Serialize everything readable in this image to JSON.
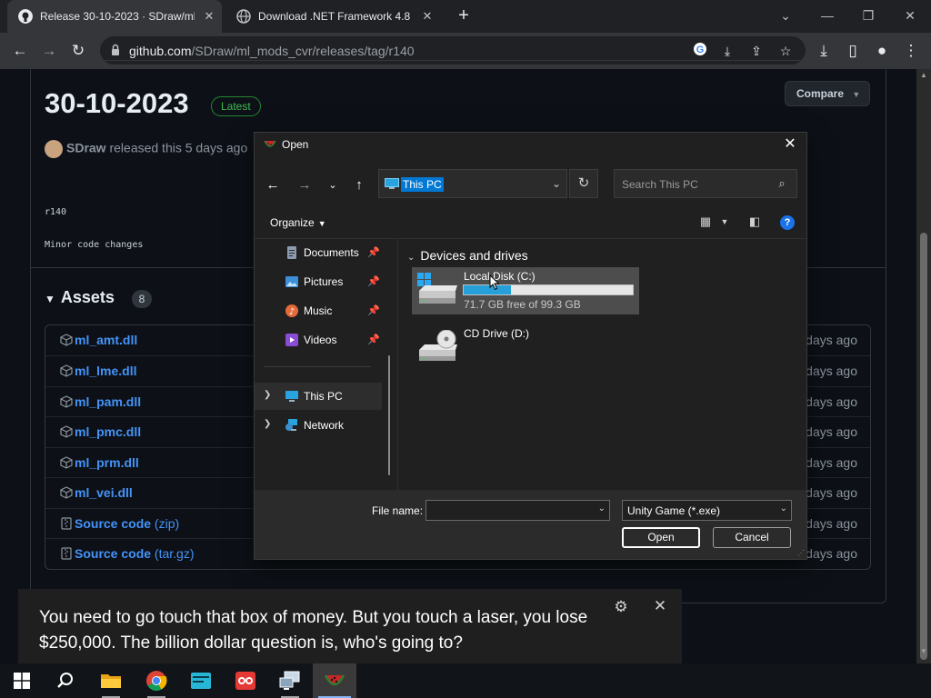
{
  "browser": {
    "tabs": [
      {
        "title": "Release 30-10-2023 · SDraw/ml_",
        "icon": "github-icon",
        "active": true
      },
      {
        "title": "Download .NET Framework 4.8 \\",
        "icon": "globe-icon",
        "active": false
      }
    ],
    "new_tab": "+",
    "window_controls": [
      "chevron-down-icon",
      "minimize-icon",
      "restore-icon",
      "close-icon"
    ],
    "url_host": "github.com",
    "url_path": "/SDraw/ml_mods_cvr/releases/tag/r140"
  },
  "release": {
    "title": "30-10-2023",
    "badge": "Latest",
    "compare_label": "Compare",
    "author": "SDraw",
    "released_text": "released this 5 days ago",
    "tag": "r140",
    "notes": "Minor code changes",
    "assets_title": "Assets",
    "assets_count": "8",
    "assets": [
      {
        "name": "ml_amt.dll",
        "ext": "",
        "date": "days ago",
        "icon": "package-icon"
      },
      {
        "name": "ml_lme.dll",
        "ext": "",
        "date": "days ago",
        "icon": "package-icon"
      },
      {
        "name": "ml_pam.dll",
        "ext": "",
        "date": "days ago",
        "icon": "package-icon"
      },
      {
        "name": "ml_pmc.dll",
        "ext": "",
        "date": "days ago",
        "icon": "package-icon"
      },
      {
        "name": "ml_prm.dll",
        "ext": "",
        "date": "days ago",
        "icon": "package-icon"
      },
      {
        "name": "ml_vei.dll",
        "ext": "",
        "date": "days ago",
        "icon": "package-icon"
      },
      {
        "name": "Source code",
        "ext": "(zip)",
        "date": "days ago",
        "icon": "zip-icon"
      },
      {
        "name": "Source code",
        "ext": "(tar.gz)",
        "date": "days ago",
        "icon": "zip-icon"
      }
    ]
  },
  "dialog": {
    "title": "Open",
    "address": "This PC",
    "search_placeholder": "Search This PC",
    "organize_label": "Organize",
    "nav_quick": [
      {
        "label": "Documents",
        "icon": "documents-icon",
        "color": "#8e9ab0"
      },
      {
        "label": "Pictures",
        "icon": "pictures-icon",
        "color": "#3b8fd9"
      },
      {
        "label": "Music",
        "icon": "music-icon",
        "color": "#e36b3a"
      },
      {
        "label": "Videos",
        "icon": "videos-icon",
        "color": "#8a4cd6"
      }
    ],
    "nav_tree": [
      {
        "label": "This PC",
        "icon": "this-pc-icon",
        "selected": true
      },
      {
        "label": "Network",
        "icon": "network-icon",
        "selected": false
      }
    ],
    "group_title": "Devices and drives",
    "drives": [
      {
        "name": "Local Disk (C:)",
        "free_text": "71.7 GB free of 99.3 GB",
        "used_fraction": 0.278,
        "selected": true
      },
      {
        "name": "CD Drive (D:)",
        "free_text": "",
        "used_fraction": null,
        "selected": false
      }
    ],
    "file_name_label": "File name:",
    "file_name_value": "",
    "file_type": "Unity Game (*.exe)",
    "open_label": "Open",
    "cancel_label": "Cancel"
  },
  "caption": {
    "text": "You need to go touch that box of money. But you touch a laser, you lose $250,000. The billion dollar question is, who's going to?"
  },
  "taskbar": {
    "items": [
      "windows-start-icon",
      "search-icon",
      "file-explorer-icon",
      "chrome-icon",
      "terminal-icon",
      "app-icon",
      "remote-desktop-icon",
      "game-icon"
    ]
  },
  "colors": {
    "accent": "#0078d4",
    "link": "#4493f8",
    "latest": "#3fb950",
    "drive_bar": "#26a0da"
  }
}
